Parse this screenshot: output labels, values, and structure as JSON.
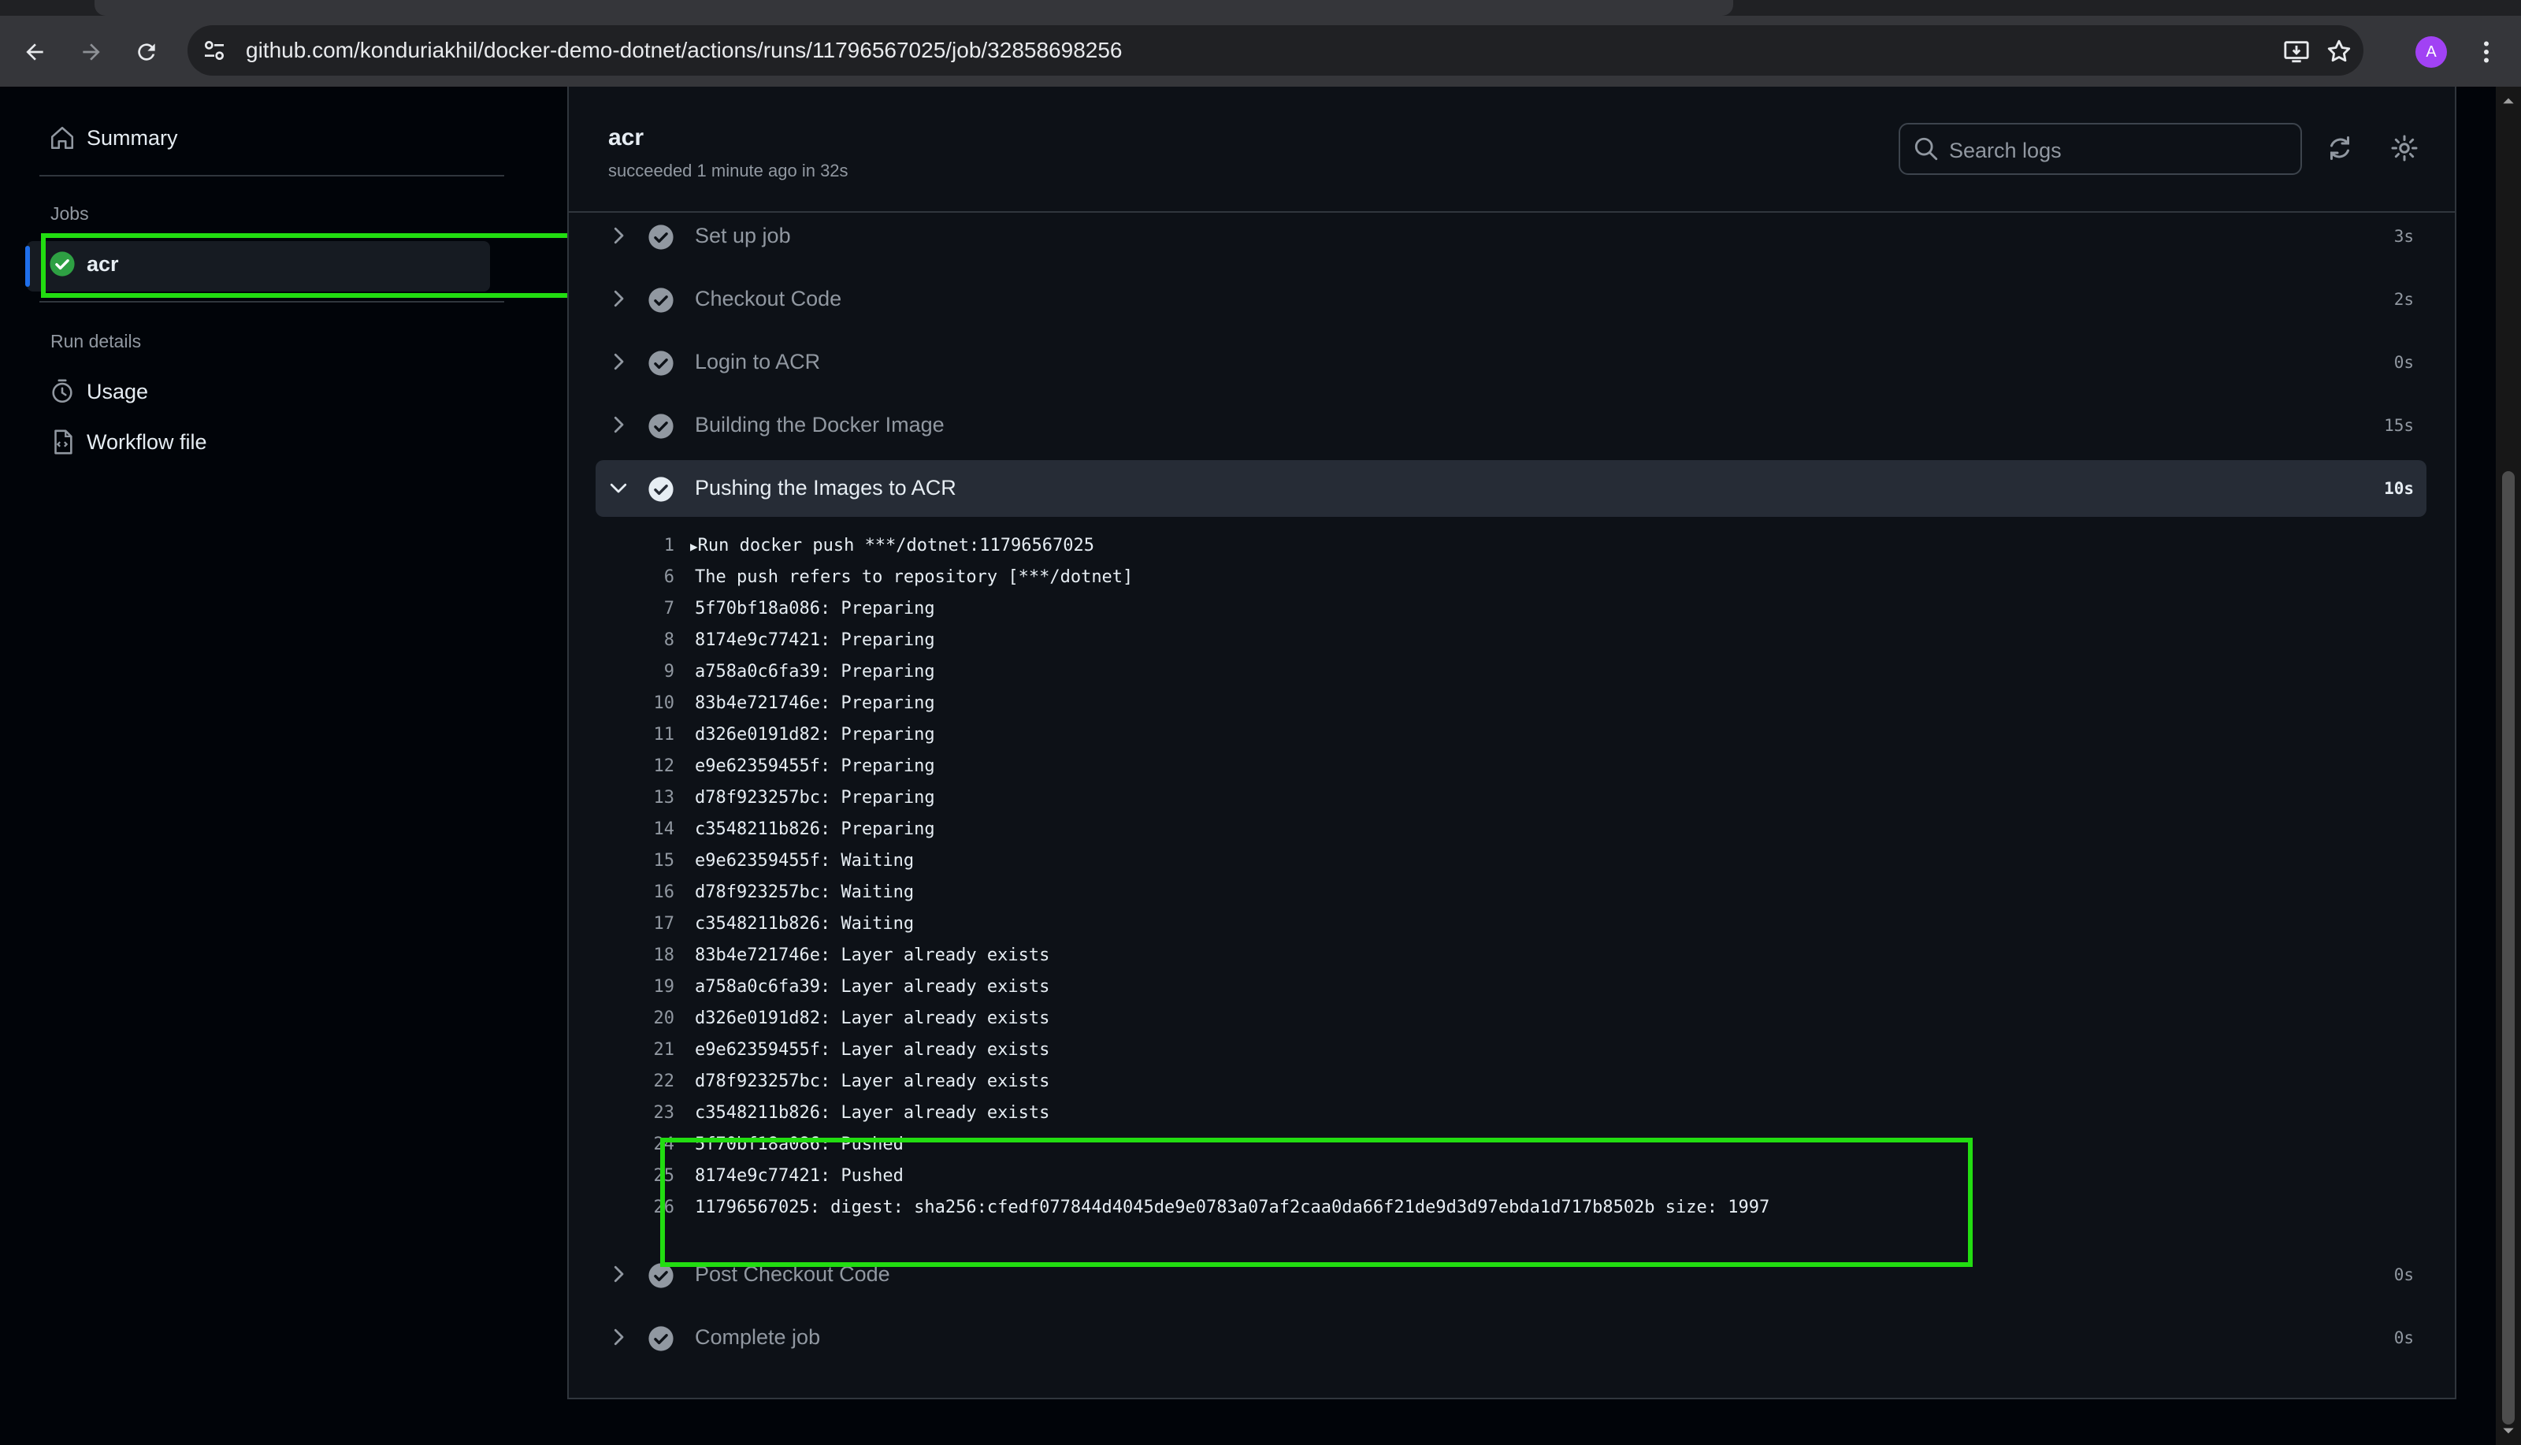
{
  "browser": {
    "url": "github.com/konduriakhil/docker-demo-dotnet/actions/runs/11796567025/job/32858698256",
    "avatar_letter": "A",
    "avatar_color": "#a142f4"
  },
  "sidebar": {
    "summary_label": "Summary",
    "jobs_heading": "Jobs",
    "job_name": "acr",
    "run_details_heading": "Run details",
    "usage_label": "Usage",
    "workflow_file_label": "Workflow file"
  },
  "header": {
    "job_title": "acr",
    "job_status": "succeeded 1 minute ago in 32s",
    "search_placeholder": "Search logs"
  },
  "steps": [
    {
      "label": "Set up job",
      "duration": "3s"
    },
    {
      "label": "Checkout Code",
      "duration": "2s"
    },
    {
      "label": "Login to ACR",
      "duration": "0s"
    },
    {
      "label": "Building the Docker Image",
      "duration": "15s"
    },
    {
      "label": "Pushing the Images to ACR",
      "duration": "10s",
      "expanded": true
    },
    {
      "label": "Post Checkout Code",
      "duration": "0s"
    },
    {
      "label": "Complete job",
      "duration": "0s"
    }
  ],
  "log_lines": [
    {
      "n": "1",
      "text": "Run docker push ***/dotnet:11796567025"
    },
    {
      "n": "6",
      "text": "The push refers to repository [***/dotnet]"
    },
    {
      "n": "7",
      "text": "5f70bf18a086: Preparing"
    },
    {
      "n": "8",
      "text": "8174e9c77421: Preparing"
    },
    {
      "n": "9",
      "text": "a758a0c6fa39: Preparing"
    },
    {
      "n": "10",
      "text": "83b4e721746e: Preparing"
    },
    {
      "n": "11",
      "text": "d326e0191d82: Preparing"
    },
    {
      "n": "12",
      "text": "e9e62359455f: Preparing"
    },
    {
      "n": "13",
      "text": "d78f923257bc: Preparing"
    },
    {
      "n": "14",
      "text": "c3548211b826: Preparing"
    },
    {
      "n": "15",
      "text": "e9e62359455f: Waiting"
    },
    {
      "n": "16",
      "text": "d78f923257bc: Waiting"
    },
    {
      "n": "17",
      "text": "c3548211b826: Waiting"
    },
    {
      "n": "18",
      "text": "83b4e721746e: Layer already exists"
    },
    {
      "n": "19",
      "text": "a758a0c6fa39: Layer already exists"
    },
    {
      "n": "20",
      "text": "d326e0191d82: Layer already exists"
    },
    {
      "n": "21",
      "text": "e9e62359455f: Layer already exists"
    },
    {
      "n": "22",
      "text": "d78f923257bc: Layer already exists"
    },
    {
      "n": "23",
      "text": "c3548211b826: Layer already exists"
    },
    {
      "n": "24",
      "text": "5f70bf18a086: Pushed"
    },
    {
      "n": "25",
      "text": "8174e9c77421: Pushed"
    },
    {
      "n": "26",
      "text": "11796567025: digest: sha256:cfedf077844d4045de9e0783a07af2caa0da66f21de9d3d97ebda1d717b8502b size: 1997"
    }
  ],
  "colors": {
    "success_green": "#2ea043",
    "annotation_green": "#22dd11",
    "accent_blue": "#1f6feb"
  }
}
